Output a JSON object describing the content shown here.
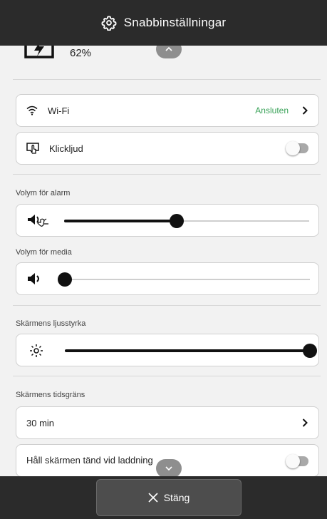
{
  "header": {
    "title": "Snabbinställningar",
    "icon": "gear-icon"
  },
  "battery": {
    "percent_label": "62%",
    "level_percent": 62
  },
  "wifi": {
    "label": "Wi-Fi",
    "status": "Ansluten",
    "status_color": "#3ba35a"
  },
  "click_sound": {
    "label": "Klickljud",
    "enabled": false
  },
  "alarm_volume": {
    "label": "Volym för alarm",
    "level_percent": 46
  },
  "media_volume": {
    "label": "Volym för media",
    "level_percent": 0
  },
  "brightness": {
    "label": "Skärmens ljusstyrka",
    "level_percent": 100
  },
  "screen_timeout": {
    "label": "Skärmens tidsgräns",
    "value": "30 min"
  },
  "keep_screen_on": {
    "label": "Håll skärmen tänd vid laddning",
    "enabled": false
  },
  "footer": {
    "close_label": "Stäng"
  }
}
